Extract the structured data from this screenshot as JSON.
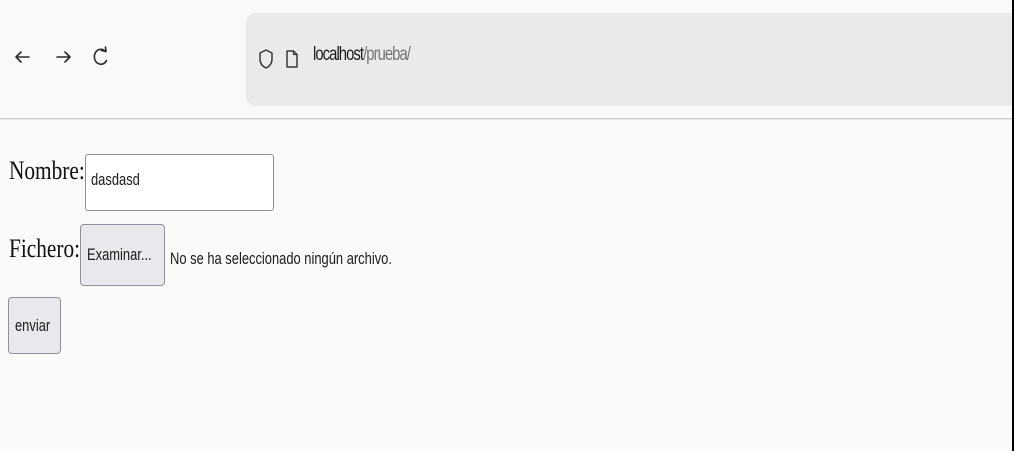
{
  "browser": {
    "url_host": "localhost",
    "url_path": "/prueba/",
    "back_icon": "arrow-left-icon",
    "forward_icon": "arrow-right-icon",
    "reload_icon": "reload-icon",
    "shield_icon": "shield-icon",
    "page_icon": "page-icon"
  },
  "form": {
    "nombre_label": "Nombre:",
    "nombre_value": "dasdasd",
    "fichero_label": "Fichero:",
    "browse_button_label": "Examinar...",
    "file_status": "No se ha seleccionado ningún archivo.",
    "submit_label": "enviar"
  }
}
